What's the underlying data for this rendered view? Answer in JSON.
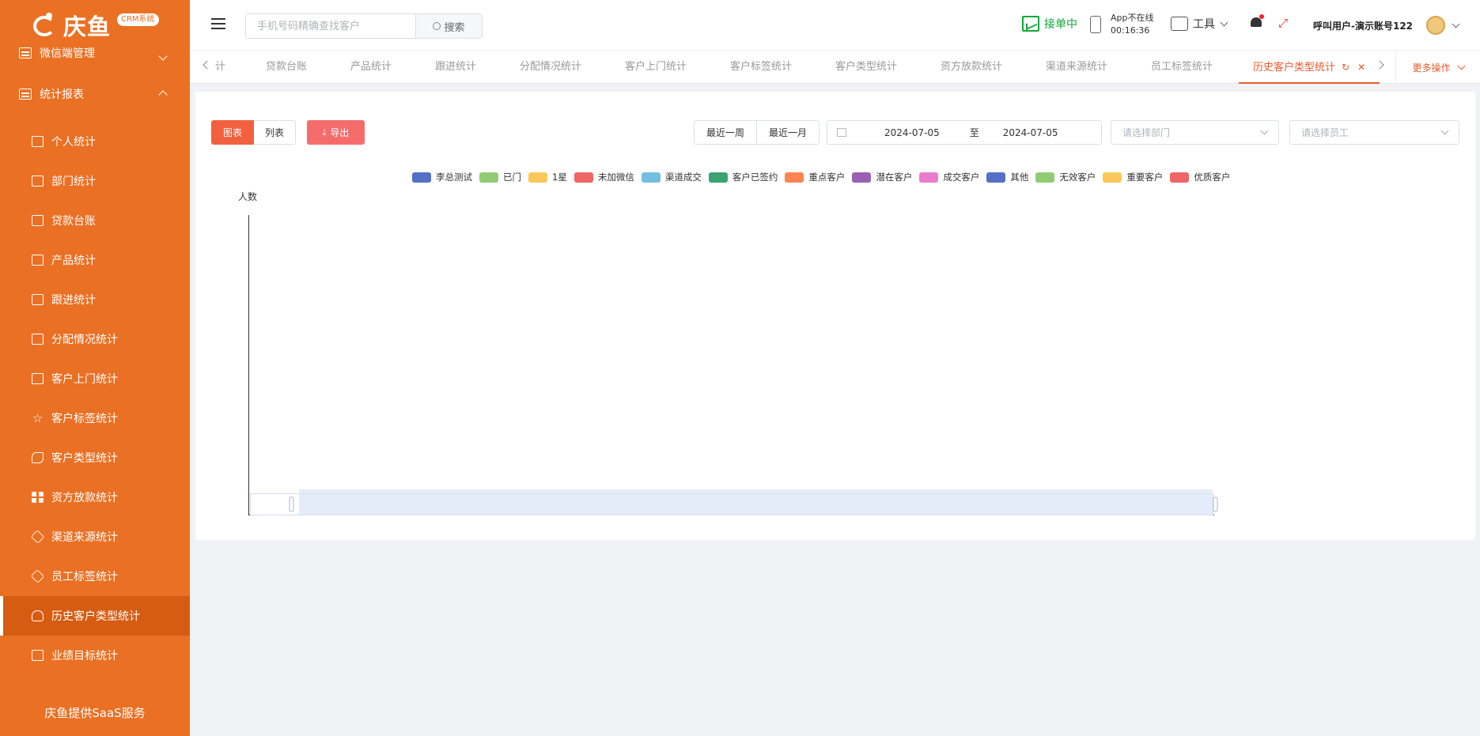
{
  "sidebar": {
    "logo_text": "庆鱼",
    "logo_badge": "CRM系统",
    "groups": [
      {
        "label": "微信端管理"
      },
      {
        "label": "统计报表"
      }
    ],
    "items": [
      {
        "label": "个人统计"
      },
      {
        "label": "部门统计"
      },
      {
        "label": "贷款台账"
      },
      {
        "label": "产品统计"
      },
      {
        "label": "跟进统计"
      },
      {
        "label": "分配情况统计"
      },
      {
        "label": "客户上门统计"
      },
      {
        "label": "客户标签统计"
      },
      {
        "label": "客户类型统计"
      },
      {
        "label": "资方放款统计"
      },
      {
        "label": "渠道来源统计"
      },
      {
        "label": "员工标签统计"
      },
      {
        "label": "历史客户类型统计"
      },
      {
        "label": "业绩目标统计"
      }
    ],
    "footer": "庆鱼提供SaaS服务"
  },
  "header": {
    "search_placeholder": "手机号码精确查找客户",
    "search_button": "搜索",
    "order_status": "接单中",
    "app_status_line1": "App不在线",
    "app_status_line2": "00:16:36",
    "tools_label": "工具",
    "caller": "呼叫用户-演示账号122"
  },
  "tabs": {
    "items": [
      {
        "label": "计"
      },
      {
        "label": "贷款台账"
      },
      {
        "label": "产品统计"
      },
      {
        "label": "跟进统计"
      },
      {
        "label": "分配情况统计"
      },
      {
        "label": "客户上门统计"
      },
      {
        "label": "客户标签统计"
      },
      {
        "label": "客户类型统计"
      },
      {
        "label": "资方放款统计"
      },
      {
        "label": "渠道来源统计"
      },
      {
        "label": "员工标签统计"
      }
    ],
    "active": "历史客户类型统计",
    "more_ops": "更多操作"
  },
  "toolbar": {
    "chart_btn": "图表",
    "list_btn": "列表",
    "export_btn": "导出",
    "last_week": "最近一周",
    "last_month": "最近一月",
    "date_start": "2024-07-05",
    "date_sep": "至",
    "date_end": "2024-07-05",
    "dept_placeholder": "请选择部门",
    "staff_placeholder": "请选择员工"
  },
  "chart_data": {
    "type": "bar",
    "ylabel": "人数",
    "categories": [],
    "series": [
      {
        "name": "李总测试",
        "color": "#5470c6",
        "values": []
      },
      {
        "name": "已门",
        "color": "#91cc75",
        "values": []
      },
      {
        "name": "1星",
        "color": "#fac858",
        "values": []
      },
      {
        "name": "未加微信",
        "color": "#ee6666",
        "values": []
      },
      {
        "name": "渠道成交",
        "color": "#73c0de",
        "values": []
      },
      {
        "name": "客户已签约",
        "color": "#3ba272",
        "values": []
      },
      {
        "name": "重点客户",
        "color": "#fc8452",
        "values": []
      },
      {
        "name": "潜在客户",
        "color": "#9a60b4",
        "values": []
      },
      {
        "name": "成交客户",
        "color": "#ea7ccc",
        "values": []
      },
      {
        "name": "其他",
        "color": "#5470c6",
        "values": []
      },
      {
        "name": "无效客户",
        "color": "#91cc75",
        "values": []
      },
      {
        "name": "重要客户",
        "color": "#fac858",
        "values": []
      },
      {
        "name": "优质客户",
        "color": "#ee6666",
        "values": []
      }
    ],
    "legend_position": "top",
    "grid": false
  }
}
